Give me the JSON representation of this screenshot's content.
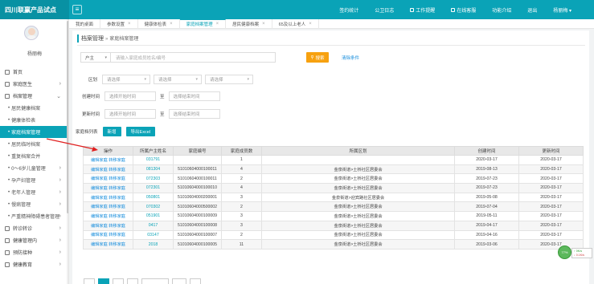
{
  "app": {
    "title": "四川联赢产品试点"
  },
  "topnav": [
    {
      "label": "签约统计",
      "icon": ""
    },
    {
      "label": "公卫日志",
      "icon": ""
    },
    {
      "label": "工作提醒",
      "icon": "bell-icon"
    },
    {
      "label": "在线客服",
      "icon": "chat-icon"
    },
    {
      "label": "功能介绍",
      "icon": ""
    },
    {
      "label": "退出",
      "icon": ""
    },
    {
      "label": "杨丽梅 ▾",
      "icon": ""
    }
  ],
  "sidebar": {
    "username": "杨丽梅",
    "items": [
      {
        "label": "首页",
        "level": "top",
        "icon": "home-icon",
        "chevron": ""
      },
      {
        "label": "家庭医生",
        "level": "top",
        "icon": "doctor-icon",
        "chevron": "›"
      },
      {
        "label": "档案管理",
        "level": "top",
        "icon": "folder-icon",
        "chevron": "⌄"
      },
      {
        "label": "居民健康档案",
        "level": "sub",
        "chevron": ""
      },
      {
        "label": "健康体检表",
        "level": "sub",
        "chevron": ""
      },
      {
        "label": "家庭档案管理",
        "level": "sub",
        "chevron": "",
        "active": true
      },
      {
        "label": "居民临时档案",
        "level": "sub",
        "chevron": ""
      },
      {
        "label": "重复档案合并",
        "level": "sub",
        "chevron": ""
      },
      {
        "label": "0～6岁儿童管理",
        "level": "sub",
        "chevron": "›"
      },
      {
        "label": "孕产妇管理",
        "level": "sub",
        "chevron": "›"
      },
      {
        "label": "老年人管理",
        "level": "sub",
        "chevron": "›"
      },
      {
        "label": "慢病管理",
        "level": "sub",
        "chevron": "›"
      },
      {
        "label": "严重精神障碍患者管理",
        "level": "sub",
        "chevron": "›"
      },
      {
        "label": "转诊转诊",
        "level": "top",
        "icon": "transfer-icon",
        "chevron": "›"
      },
      {
        "label": "健康管理内",
        "level": "top",
        "icon": "health-icon",
        "chevron": "›"
      },
      {
        "label": "预防接种",
        "level": "top",
        "icon": "vaccine-icon",
        "chevron": "›"
      },
      {
        "label": "健康教育",
        "level": "top",
        "icon": "education-icon",
        "chevron": "›"
      }
    ]
  },
  "tabs": [
    {
      "label": "我的桌面",
      "active": false
    },
    {
      "label": "参数设置",
      "active": false
    },
    {
      "label": "健康体检表",
      "active": false
    },
    {
      "label": "家庭档案管理",
      "active": true
    },
    {
      "label": "居民健康档案",
      "active": false
    },
    {
      "label": "65及以上老人",
      "active": false
    }
  ],
  "breadcrumb": {
    "root": "档案管理",
    "sep": "»",
    "current": "家庭档案管理"
  },
  "search": {
    "type_label": "户主",
    "placeholder": "请输入家庭成员姓名/编号",
    "button": "搜索",
    "reset": "清除条件"
  },
  "filters": {
    "region_label": "区划",
    "region_options": [
      "请选择",
      "请选择",
      "请选择"
    ],
    "created_label": "创建时间",
    "created_start": "选择开始时间",
    "created_end": "选择结束时间",
    "updated_label": "更新时间",
    "updated_start": "选择开始时间",
    "updated_end": "选择结束时间",
    "to": "至"
  },
  "actions": {
    "title": "家庭档列表",
    "add": "新增",
    "export": "导出Excel"
  },
  "table": {
    "headers": [
      "操作",
      "所属户主姓名",
      "家庭编号",
      "家庭成员数",
      "所属区划",
      "创建时间",
      "更新时间"
    ],
    "rows": [
      {
        "ops": "编辑家庭  转移家庭",
        "name": "031791",
        "code": "",
        "count": "1",
        "region": "",
        "created": "2020-03-17",
        "updated": "2020-03-17"
      },
      {
        "ops": "编辑家庭  转移家庭",
        "name": "081304",
        "code": "51010604000100011",
        "count": "4",
        "region": "金泉街道>土桥社区居委会",
        "created": "2019-08-13",
        "updated": "2020-03-17"
      },
      {
        "ops": "编辑家庭  转移家庭",
        "name": "072303",
        "code": "51010604000100011",
        "count": "2",
        "region": "金泉街道>土桥社区居委会",
        "created": "2019-07-23",
        "updated": "2020-03-17"
      },
      {
        "ops": "编辑家庭  转移家庭",
        "name": "072301",
        "code": "51010604000100010",
        "count": "4",
        "region": "金泉街道>土桥社区居委会",
        "created": "2019-07-23",
        "updated": "2020-03-17"
      },
      {
        "ops": "编辑家庭  转移家庭",
        "name": "050801",
        "code": "51010604000200001",
        "count": "3",
        "region": "金泉街道>迎宾路社区居委会",
        "created": "2019-05-08",
        "updated": "2020-03-17"
      },
      {
        "ops": "编辑家庭  转移家庭",
        "name": "070302",
        "code": "51010604000500002",
        "count": "2",
        "region": "金泉街道>土桥社区居委会",
        "created": "2019-07-04",
        "updated": "2020-03-17"
      },
      {
        "ops": "编辑家庭  转移家庭",
        "name": "051901",
        "code": "51010604000100009",
        "count": "3",
        "region": "金泉街道>土桥社区居委会",
        "created": "2019-05-11",
        "updated": "2020-03-17"
      },
      {
        "ops": "编辑家庭  转移家庭",
        "name": "0417",
        "code": "51010604000100008",
        "count": "3",
        "region": "金泉街道>土桥社区居委会",
        "created": "2019-04-17",
        "updated": "2020-03-17"
      },
      {
        "ops": "编辑家庭  转移家庭",
        "name": "03147",
        "code": "51010604000100007",
        "count": "2",
        "region": "金泉街道>土桥社区居委会",
        "created": "2019-04-16",
        "updated": "2020-03-17"
      },
      {
        "ops": "编辑家庭  转移家庭",
        "name": "2018",
        "code": "51010604000100005",
        "count": "11",
        "region": "金泉街道>土桥社区居委会",
        "created": "2019-03-06",
        "updated": "2020-03-17"
      }
    ]
  },
  "float_widget": {
    "badge": "77%",
    "up": "↑ 0K/s",
    "down": "↓ 0.1K/s"
  },
  "colors": {
    "accent": "#0aa3b7",
    "search_button": "#f7a10f",
    "link": "#1a8fdd",
    "arrow": "#e02020"
  }
}
